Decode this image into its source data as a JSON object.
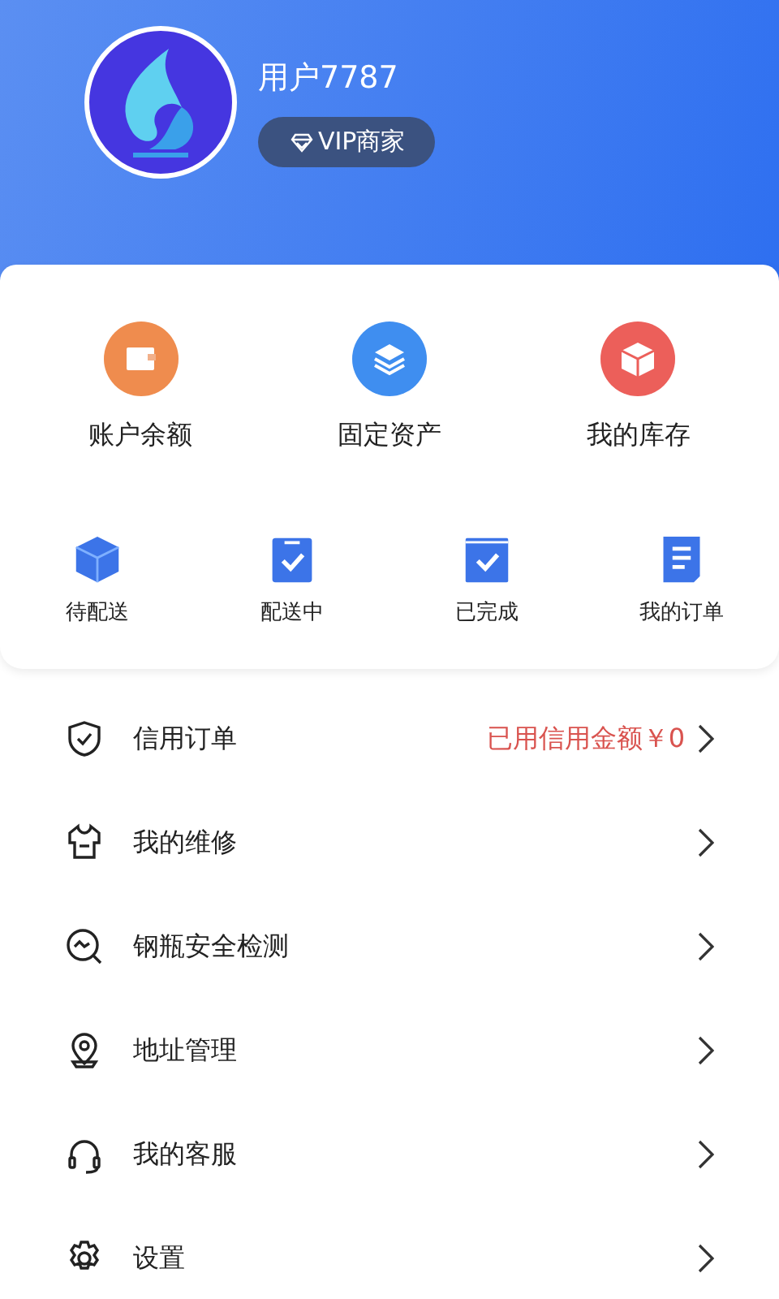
{
  "profile": {
    "username": "用户7787",
    "badge": "VIP商家"
  },
  "assets": [
    {
      "label": "账户余额"
    },
    {
      "label": "固定资产"
    },
    {
      "label": "我的库存"
    }
  ],
  "orders": [
    {
      "label": "待配送"
    },
    {
      "label": "配送中"
    },
    {
      "label": "已完成"
    },
    {
      "label": "我的订单"
    }
  ],
  "menu": [
    {
      "label": "信用订单",
      "value": "已用信用金额￥0"
    },
    {
      "label": "我的维修"
    },
    {
      "label": "钢瓶安全检测"
    },
    {
      "label": "地址管理"
    },
    {
      "label": "我的客服"
    },
    {
      "label": "设置"
    }
  ]
}
